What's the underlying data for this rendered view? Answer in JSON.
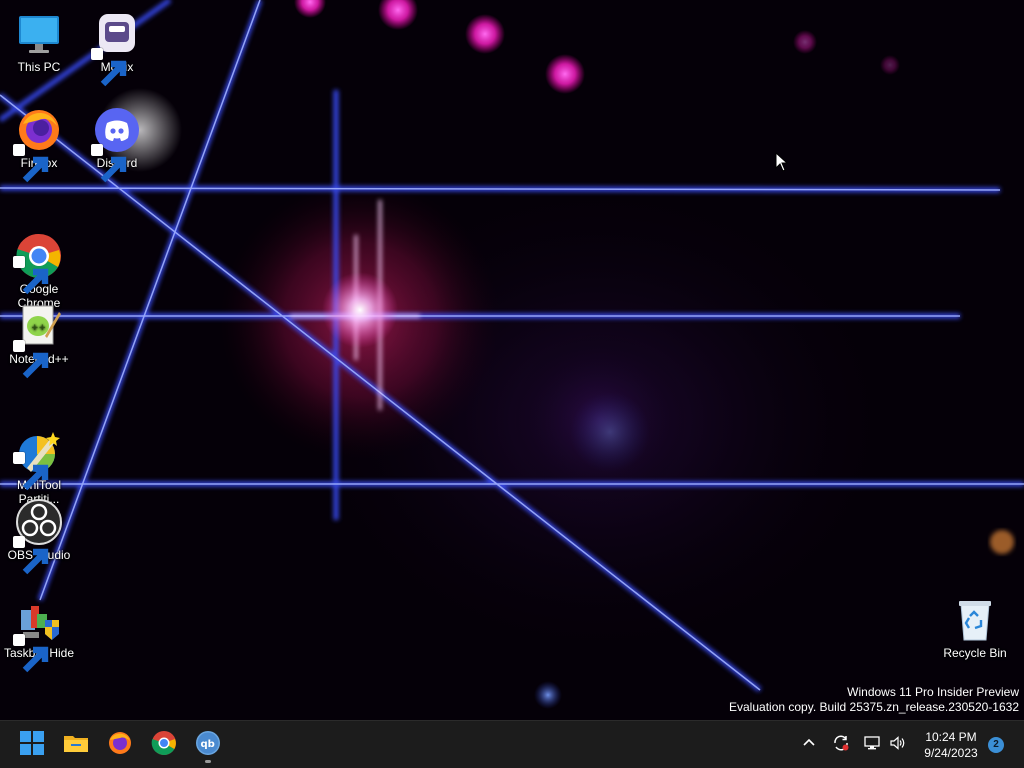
{
  "desktop": {
    "icons": [
      {
        "label": "This PC",
        "icon": "monitor-icon"
      },
      {
        "label": "Motrix",
        "icon": "motrix-icon"
      },
      {
        "label": "Firefox",
        "icon": "firefox-icon"
      },
      {
        "label": "Discord",
        "icon": "discord-icon"
      },
      {
        "label": "Google\nChrome",
        "icon": "chrome-icon"
      },
      {
        "label": "Notepad++",
        "icon": "notepadpp-icon"
      },
      {
        "label": "MiniTool\nPartiti...",
        "icon": "minitool-icon"
      },
      {
        "label": "OBS Studio",
        "icon": "obs-icon"
      },
      {
        "label": "Taskbar Hide",
        "icon": "taskbar-hide-icon"
      },
      {
        "label": "Recycle Bin",
        "icon": "recycle-bin-icon"
      }
    ],
    "watermark": {
      "line1": "Windows 11 Pro Insider Preview",
      "line2": "Evaluation copy. Build 25375.zn_release.230520-1632"
    }
  },
  "taskbar": {
    "pinned": [
      {
        "name": "Start",
        "icon": "windows-start-icon"
      },
      {
        "name": "File Explorer",
        "icon": "folder-icon"
      },
      {
        "name": "Firefox",
        "icon": "firefox-icon"
      },
      {
        "name": "Google Chrome",
        "icon": "chrome-icon"
      },
      {
        "name": "qBittorrent",
        "icon": "qbittorrent-icon",
        "running": true
      }
    ],
    "tray": {
      "icons": [
        "chevron-up-icon",
        "sync-icon",
        "network-icon",
        "volume-icon"
      ],
      "time": "10:24 PM",
      "date": "9/24/2023",
      "notification_count": "2"
    }
  },
  "colors": {
    "taskbar_bg": "#1c1c1c",
    "accent": "#3b8fd6",
    "wallpaper_base": "#050008"
  }
}
